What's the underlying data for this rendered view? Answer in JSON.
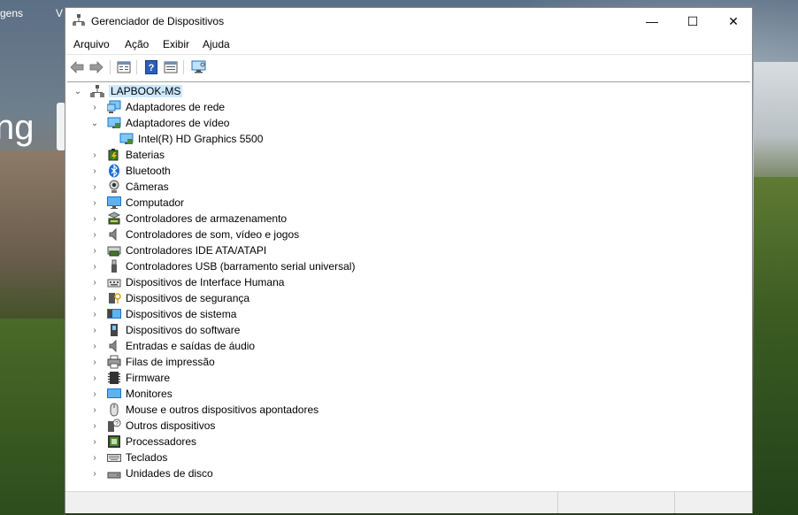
{
  "background": {
    "top_left_text": "gens",
    "top_left_text2": "V",
    "big_text": "ng"
  },
  "window": {
    "title": "Gerenciador de Dispositivos",
    "buttons": {
      "minimize": "—",
      "maximize": "☐",
      "close": "✕"
    }
  },
  "menu": [
    "Arquivo",
    "Ação",
    "Exibir",
    "Ajuda"
  ],
  "toolbar": {
    "icons": [
      "back-arrow-icon",
      "forward-arrow-icon",
      "properties-icon",
      "help-icon",
      "update-driver-icon",
      "scan-hardware-icon"
    ]
  },
  "tree": {
    "root": {
      "label": "LAPBOOK-MS",
      "icon": "computer-tree-icon"
    },
    "items": [
      {
        "label": "Adaptadores de rede",
        "icon": "network-adapter-icon",
        "expanded": false
      },
      {
        "label": "Adaptadores de vídeo",
        "icon": "display-adapter-icon",
        "expanded": true,
        "children": [
          {
            "label": "Intel(R) HD Graphics 5500",
            "icon": "display-adapter-icon"
          }
        ]
      },
      {
        "label": "Baterias",
        "icon": "battery-icon",
        "expanded": false
      },
      {
        "label": "Bluetooth",
        "icon": "bluetooth-icon",
        "expanded": false
      },
      {
        "label": "Câmeras",
        "icon": "camera-icon",
        "expanded": false
      },
      {
        "label": "Computador",
        "icon": "monitor-icon",
        "expanded": false
      },
      {
        "label": "Controladores de armazenamento",
        "icon": "storage-controller-icon",
        "expanded": false
      },
      {
        "label": "Controladores de som, vídeo e jogos",
        "icon": "speaker-icon",
        "expanded": false
      },
      {
        "label": "Controladores IDE ATA/ATAPI",
        "icon": "ide-controller-icon",
        "expanded": false
      },
      {
        "label": "Controladores USB (barramento serial universal)",
        "icon": "usb-icon",
        "expanded": false
      },
      {
        "label": "Dispositivos de Interface Humana",
        "icon": "hid-icon",
        "expanded": false
      },
      {
        "label": "Dispositivos de segurança",
        "icon": "security-key-icon",
        "expanded": false
      },
      {
        "label": "Dispositivos de sistema",
        "icon": "system-device-icon",
        "expanded": false
      },
      {
        "label": "Dispositivos do software",
        "icon": "software-device-icon",
        "expanded": false
      },
      {
        "label": "Entradas e saídas de áudio",
        "icon": "audio-io-icon",
        "expanded": false
      },
      {
        "label": "Filas de impressão",
        "icon": "printer-icon",
        "expanded": false
      },
      {
        "label": "Firmware",
        "icon": "firmware-icon",
        "expanded": false
      },
      {
        "label": "Monitores",
        "icon": "monitor-icon",
        "expanded": false
      },
      {
        "label": "Mouse e outros dispositivos apontadores",
        "icon": "mouse-icon",
        "expanded": false
      },
      {
        "label": "Outros dispositivos",
        "icon": "unknown-device-icon",
        "expanded": false
      },
      {
        "label": "Processadores",
        "icon": "processor-icon",
        "expanded": false
      },
      {
        "label": "Teclados",
        "icon": "keyboard-icon",
        "expanded": false
      },
      {
        "label": "Unidades de disco",
        "icon": "disk-drive-icon",
        "expanded": false
      }
    ]
  },
  "colors": {
    "selection": "#cce8ff",
    "accent_blue": "#1e74c8",
    "bluetooth": "#1c6fd1"
  }
}
